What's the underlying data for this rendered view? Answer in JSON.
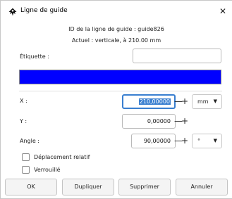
{
  "window": {
    "title": "Ligne de guide",
    "icon": "inkscape-icon",
    "close_glyph": "✕"
  },
  "info": {
    "guide_id": "ID de la ligne de guide : guide826",
    "current": "Actuel : verticale, à 210.00 mm"
  },
  "label_field": {
    "label": "Étiquette :",
    "value": ""
  },
  "color": {
    "value": "#0000ff"
  },
  "x_field": {
    "label": "X :",
    "value": "210,00000",
    "minus": "—",
    "plus": "+",
    "unit": "mm",
    "unit_arrow": "▼"
  },
  "y_field": {
    "label": "Y :",
    "value": "0,00000",
    "minus": "—",
    "plus": "+"
  },
  "angle_field": {
    "label": "Angle :",
    "value": "90,00000",
    "minus": "—",
    "plus": "+",
    "unit": "°",
    "unit_arrow": "▼"
  },
  "options": {
    "relative": {
      "label": "Déplacement relatif",
      "checked": false
    },
    "locked": {
      "label": "Verrouillé",
      "checked": false
    }
  },
  "buttons": {
    "ok": "OK",
    "duplicate": "Dupliquer",
    "delete": "Supprimer",
    "cancel": "Annuler"
  }
}
